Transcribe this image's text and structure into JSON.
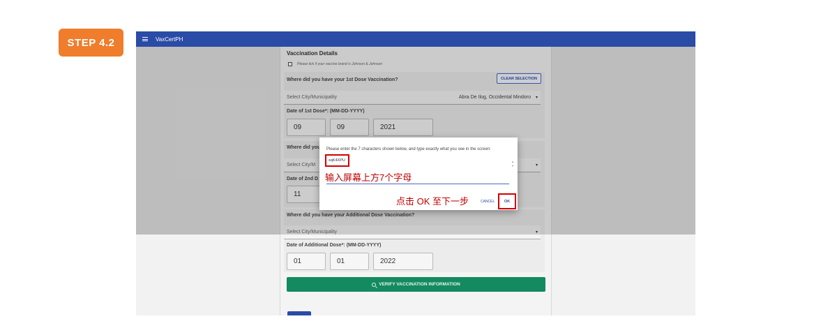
{
  "step_badge": "STEP 4.2",
  "app": {
    "title": "VaxCertPH",
    "menu_icon": "hamburger-menu-icon"
  },
  "form": {
    "section_title": "Vaccination Details",
    "jj_checkbox_label": "Please tick if your vaccine brand is Johnson & Johnson",
    "clear_selection": "CLEAR SELECTION",
    "dose1": {
      "question": "Where did you have your 1st Dose Vaccination?",
      "select_placeholder": "Select City/Municipality",
      "select_value": "Abra De Ilog, Occidental Mindoro",
      "date_label": "Date of 1st Dose*: (MM-DD-YYYY)",
      "month": "09",
      "day": "09",
      "year": "2021"
    },
    "dose2": {
      "question_partial": "Where did you",
      "select_partial": "Select City/M",
      "date_label_partial": "Date of 2nd D",
      "month": "11"
    },
    "additional": {
      "question": "Where did you have your Additional Dose Vaccination?",
      "select_placeholder": "Select City/Municipality",
      "date_label": "Date of Additional Dose*: (MM-DD-YYYY)",
      "month": "01",
      "day": "01",
      "year": "2022"
    },
    "verify_button": "VERIFY VACCINATION INFORMATION"
  },
  "dialog": {
    "prompt": "Please enter the 7 characters shown below, and type exactly what you see in the screen:",
    "captcha_text": "sqK4XPU",
    "input_hint_annotation": "输入屏幕上方7个字母",
    "ok_hint_annotation": "点击 OK 至下一步",
    "cancel_label": "CANCEL",
    "ok_label": "OK"
  },
  "colors": {
    "accent": "#2a4ba6",
    "badge": "#ef7d2b",
    "verify": "#138a5f",
    "annotation": "#d20000"
  }
}
